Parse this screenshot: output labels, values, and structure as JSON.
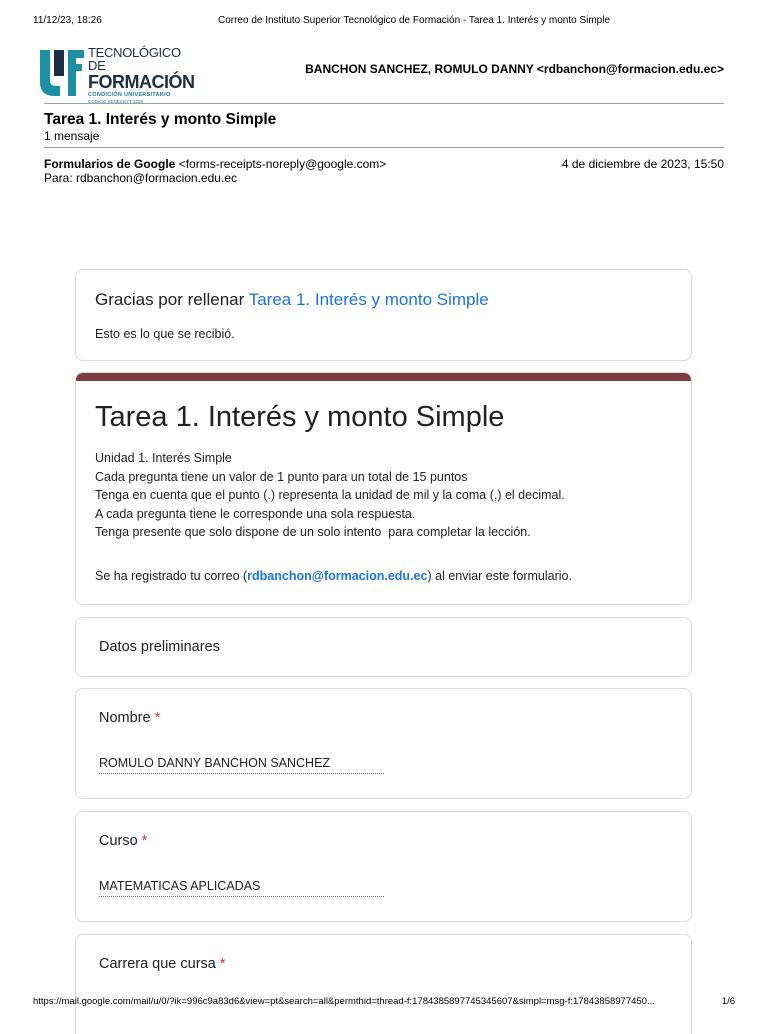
{
  "print_header": {
    "datetime": "11/12/23, 18:26",
    "title": "Correo de Instituto Superior Tecnológico de Formación - Tarea 1. Interés y monto Simple"
  },
  "logo": {
    "line1": "TECNOLÓGICO DE",
    "line2": "FORMACIÓN",
    "line3": "CONDICIÓN UNIVERSITARIO",
    "line4": "CÓDIGO SENESCYT 2209",
    "colors": {
      "teal": "#1d8fa3",
      "navy": "#1d2d44"
    }
  },
  "account": "BANCHON SANCHEZ, ROMULO DANNY <rdbanchon@formacion.edu.ec>",
  "email": {
    "subject": "Tarea 1. Interés y monto Simple",
    "message_count": "1 mensaje",
    "sender_name": "Formularios de Google",
    "sender_address": "<forms-receipts-noreply@google.com>",
    "date": "4 de diciembre de 2023, 15:50",
    "recipient": "Para: rdbanchon@formacion.edu.ec"
  },
  "receipt": {
    "thanks_prefix": "Gracias por rellenar",
    "form_link": "Tarea 1. Interés y monto Simple",
    "subtitle": "Esto es lo que se recibió."
  },
  "form": {
    "accent_color": "#7b3f3f",
    "title": "Tarea 1. Interés y monto Simple",
    "description_lines": [
      "Unidad 1. Interés Simple",
      "Cada pregunta tiene un valor de 1 punto para un total de 15 puntos",
      "Tenga en cuenta que el punto (.) representa la unidad de mil y la coma (,) el decimal.",
      "A cada pregunta tiene le corresponde una sola respuesta.",
      "Tenga presente que solo dispone de un solo intento  para completar la lección."
    ],
    "email_prefix": "Se ha registrado tu correo (",
    "email": "rdbanchon@formacion.edu.ec",
    "email_suffix": ") al enviar este formulario."
  },
  "section_title": "Datos preliminares",
  "questions": [
    {
      "label": "Nombre",
      "required_mark": "*",
      "answer": "ROMULO DANNY BANCHON SANCHEZ"
    },
    {
      "label": "Curso",
      "required_mark": "*",
      "answer": "MATEMATICAS APLICADAS"
    },
    {
      "label": "Carrera que cursa",
      "required_mark": "*"
    }
  ],
  "print_footer": {
    "url": "https://mail.google.com/mail/u/0/?ik=996c9a83d6&view=pt&search=all&permthid=thread-f:1784385897745345607&simpl=msg-f:17843858977450...",
    "page": "1/6"
  }
}
